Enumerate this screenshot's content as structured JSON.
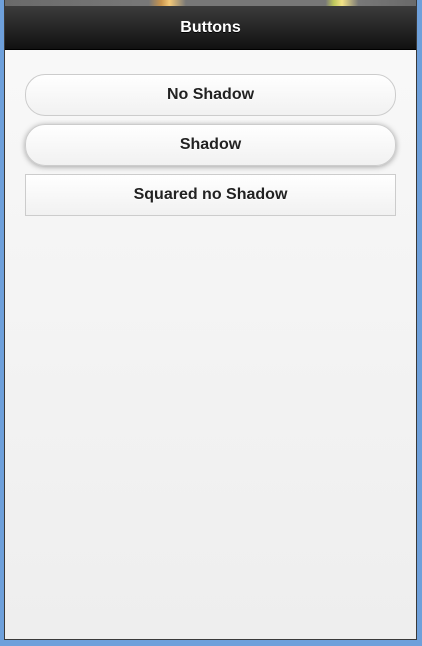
{
  "header": {
    "title": "Buttons"
  },
  "buttons": [
    {
      "label": "No Shadow",
      "style": "rounded"
    },
    {
      "label": "Shadow",
      "style": "rounded-shadow"
    },
    {
      "label": "Squared no Shadow",
      "style": "squared"
    }
  ],
  "colors": {
    "header_background": "#111111",
    "header_text": "#ffffff",
    "page_background": "#f4f4f4",
    "button_border": "#cccccc",
    "button_text": "#222222",
    "outer_frame": "#6ea0db"
  }
}
